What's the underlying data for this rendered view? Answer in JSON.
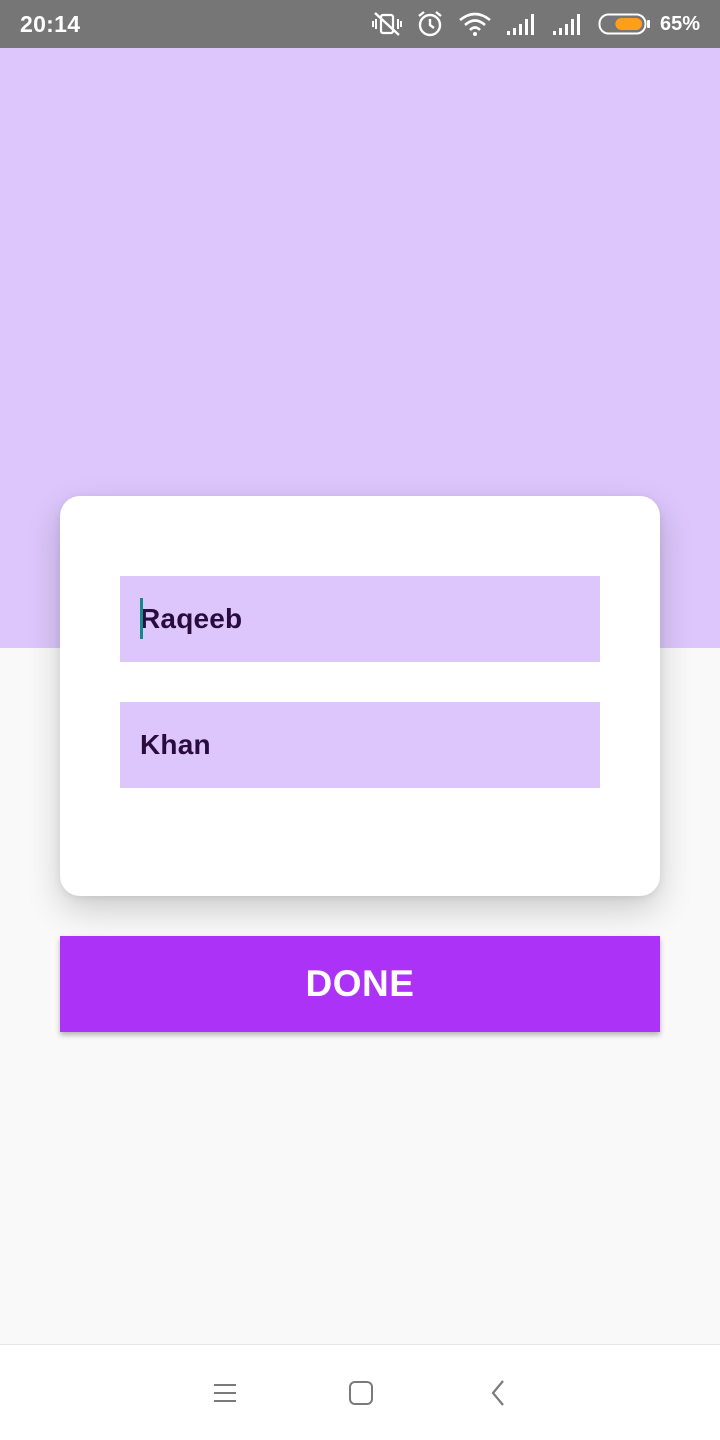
{
  "status_bar": {
    "time": "20:14",
    "battery_percent": "65%",
    "battery_level": 0.65,
    "icons": [
      "vibrate-off-icon",
      "alarm-icon",
      "wifi-icon",
      "signal-icon",
      "signal-icon",
      "battery-icon"
    ]
  },
  "form": {
    "first_name_value": "Raqeeb",
    "last_name_value": "Khan"
  },
  "actions": {
    "done_label": "DONE"
  },
  "nav_bar": {
    "icons": [
      "menu-icon",
      "home-icon",
      "back-icon"
    ]
  },
  "colors": {
    "header_bg": "#dcc6fb",
    "field_bg": "#dcc6fb",
    "field_text": "#2a0b3e",
    "accent": "#ad32f7",
    "caret": "#138a8a",
    "status_bar_bg": "#767676"
  }
}
